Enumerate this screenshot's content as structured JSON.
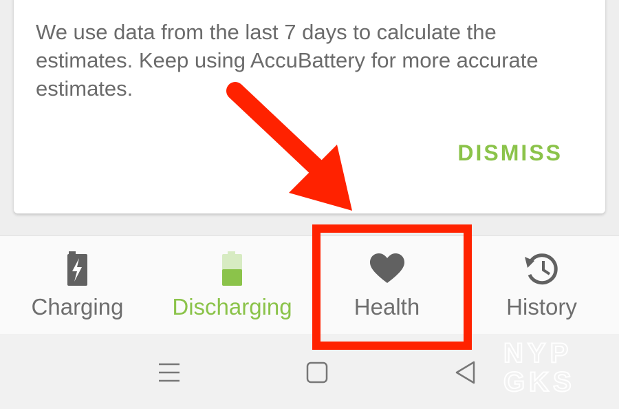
{
  "card": {
    "message": "We use data from the last 7 days to calculate the estimates. Keep using AccuBattery for more accurate estimates.",
    "dismiss_label": "DISMISS"
  },
  "bottom_nav": {
    "items": [
      {
        "label": "Charging",
        "icon": "battery-charging-icon",
        "active": false
      },
      {
        "label": "Discharging",
        "icon": "battery-discharging-icon",
        "active": true
      },
      {
        "label": "Health",
        "icon": "heart-icon",
        "active": false,
        "highlighted": true
      },
      {
        "label": "History",
        "icon": "history-icon",
        "active": false
      }
    ]
  },
  "system_nav": {
    "buttons": [
      "menu-icon",
      "home-icon",
      "back-icon"
    ]
  },
  "watermark": {
    "line1": "NYP",
    "line2": "GKS"
  },
  "colors": {
    "accent": "#8bc34a",
    "icon_gray": "#616161",
    "text_gray": "#6e6e6e",
    "annotation_red": "#ff2200"
  }
}
